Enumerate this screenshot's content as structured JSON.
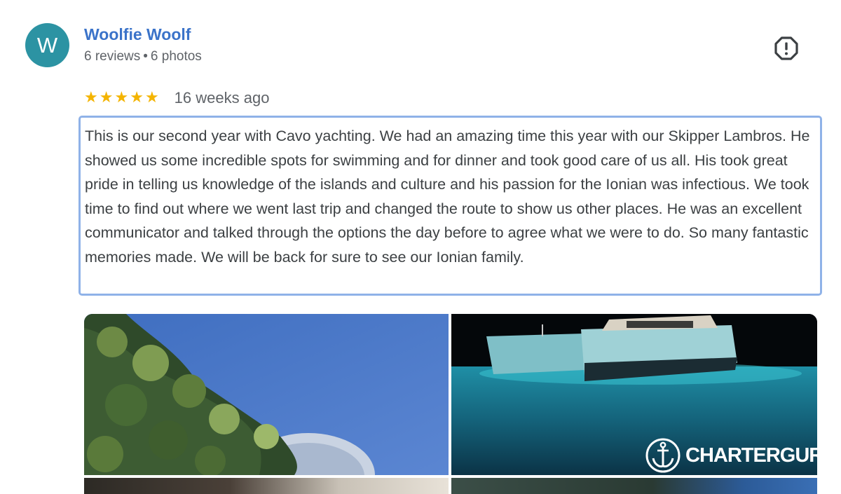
{
  "reviewer": {
    "initial": "W",
    "name": "Woolfie Woolf",
    "reviews": "6 reviews",
    "separator": "•",
    "photos": "6 photos",
    "avatar_color": "#2c93a3",
    "name_color": "#3b73c9"
  },
  "report": {
    "icon": "report-icon"
  },
  "rating": {
    "value": 5,
    "max": 5,
    "star": "★",
    "star_color": "#f4b400",
    "timestamp": "16 weeks ago"
  },
  "review": {
    "text": "This is our second year with Cavo yachting. We had an amazing time this year with our Skipper Lambros. He showed us some incredible spots for swimming and for dinner and took good care of us all. His took great pride in telling us knowledge of the islands and culture and his passion for the Ionian was infectious. We took time to find out where we went last trip and changed the route to show us other places. He was an excellent communicator and talked through the options the day before to agree what we were to do. So many fantastic memories made. We will be back for sure to see our Ionian family."
  },
  "photos": [
    {
      "subject": "pine tree and blue dome under blue sky"
    },
    {
      "subject": "catamaran at night over lit turquoise water"
    },
    {
      "subject": "rocky cliffs"
    },
    {
      "subject": "hillside over sea"
    }
  ],
  "watermark": {
    "text": "CHARTERGURU",
    "icon": "anchor-icon"
  }
}
